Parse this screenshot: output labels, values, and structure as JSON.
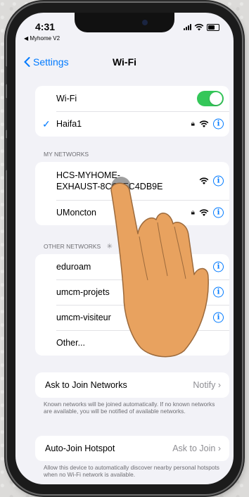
{
  "status_bar": {
    "time": "4:31",
    "back_app": "◀ Myhome V2"
  },
  "nav": {
    "back_label": "Settings",
    "title": "Wi-Fi"
  },
  "wifi": {
    "toggle_label": "Wi-Fi",
    "toggle_on": true,
    "connected_network": "Haifa1"
  },
  "my_networks": {
    "header": "MY NETWORKS",
    "items": [
      {
        "name_line1": "HCS-MYHOME-",
        "name_line2": "EXHAUST-8CC8EC4DB9E",
        "locked": false
      },
      {
        "name": "UMoncton",
        "locked": true
      }
    ]
  },
  "other_networks": {
    "header": "OTHER NETWORKS",
    "items": [
      "eduroam",
      "umcm-projets",
      "umcm-visiteur",
      "Other..."
    ]
  },
  "ask_to_join": {
    "label": "Ask to Join Networks",
    "value": "Notify",
    "footnote": "Known networks will be joined automatically. If no known networks are available, you will be notified of available networks."
  },
  "auto_join": {
    "label": "Auto-Join Hotspot",
    "value": "Ask to Join",
    "footnote": "Allow this device to automatically discover nearby personal hotspots when no Wi-Fi network is available."
  },
  "colors": {
    "accent": "#007aff",
    "toggle_on": "#34c759",
    "hand": "#e8a25f"
  },
  "icons": [
    "wifi-icon",
    "lock-icon",
    "info-icon",
    "chevron-right-icon",
    "checkmark-icon",
    "spinner-icon"
  ]
}
